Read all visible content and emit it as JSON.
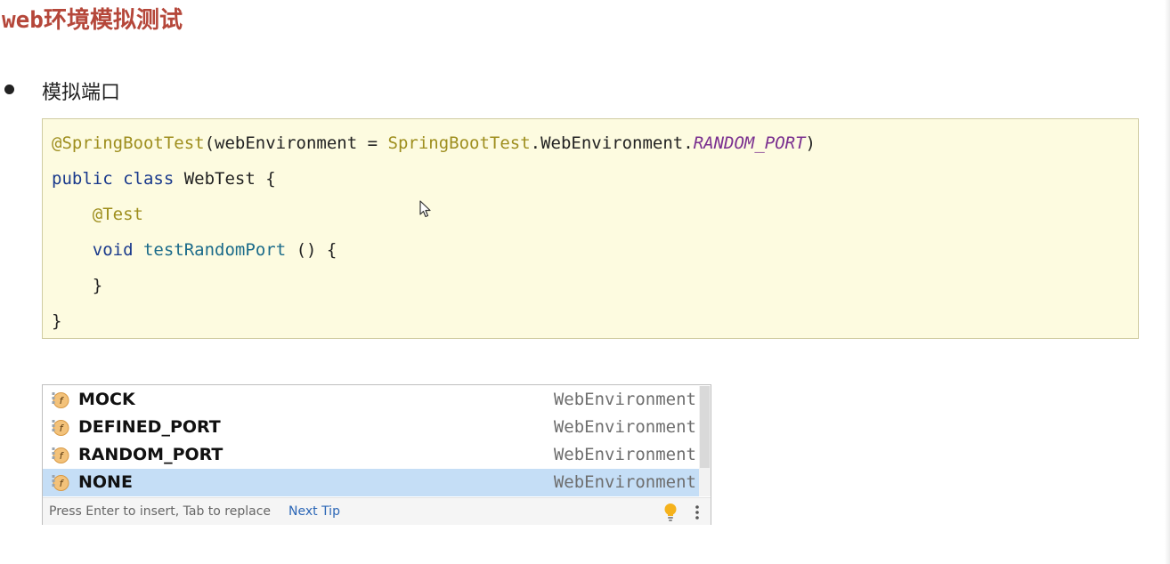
{
  "page": {
    "title": "web环境模拟测试"
  },
  "bullet": {
    "label": "模拟端口"
  },
  "code": {
    "line1": {
      "annotation": "@SpringBootTest",
      "open": "(webEnvironment = ",
      "class_ref": "SpringBootTest",
      "mid": ".WebEnvironment.",
      "constant": "RANDOM_PORT",
      "close": ")"
    },
    "line2": {
      "kw1": "public",
      "kw2": "class",
      "name": " WebTest {"
    },
    "line3": {
      "annotation": "@Test"
    },
    "line4": {
      "kw": "void",
      "method": "testRandomPort",
      "rest": " () {"
    },
    "line5": {
      "text": "}"
    },
    "line6": {
      "text": "}"
    }
  },
  "popup": {
    "items": [
      {
        "label": "MOCK",
        "type": "WebEnvironment",
        "selected": false
      },
      {
        "label": "DEFINED_PORT",
        "type": "WebEnvironment",
        "selected": false
      },
      {
        "label": "RANDOM_PORT",
        "type": "WebEnvironment",
        "selected": false
      },
      {
        "label": "NONE",
        "type": "WebEnvironment",
        "selected": true
      }
    ],
    "item_icon": "field-icon",
    "item_icon_letter": "f",
    "footer_hint": "Press Enter to insert, Tab to replace",
    "footer_link": "Next Tip"
  },
  "colors": {
    "title": "#b5473a",
    "code_background": "#fdfbe0",
    "annotation": "#9e8e1e",
    "keyword": "#1a3a8c",
    "constant": "#7a2f8f",
    "selection": "#c5def6",
    "link": "#2b66b6"
  }
}
